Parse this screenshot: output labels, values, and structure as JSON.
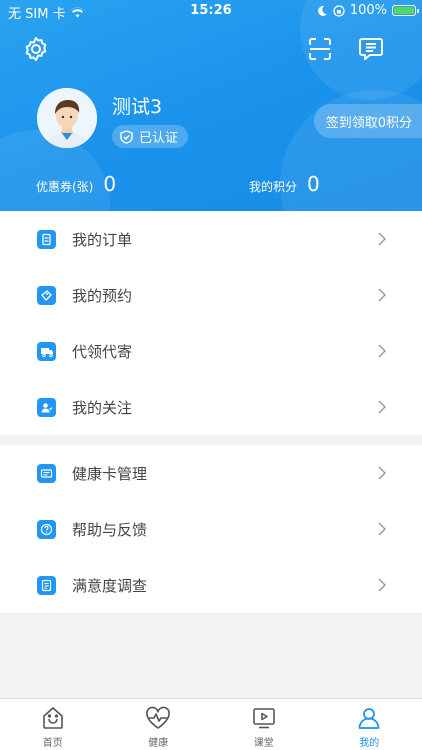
{
  "status_bar": {
    "carrier": "无 SIM 卡",
    "time": "15:26",
    "battery": "100%"
  },
  "profile": {
    "name": "测试3",
    "verified_label": "已认证",
    "signin_label": "签到领取0积分",
    "coupon_label": "优惠券(张)",
    "coupon_value": "0",
    "points_label": "我的积分",
    "points_value": "0"
  },
  "menu_group_1": [
    {
      "label": "我的订单",
      "icon": "order-icon"
    },
    {
      "label": "我的预约",
      "icon": "appointment-icon"
    },
    {
      "label": "代领代寄",
      "icon": "delivery-icon"
    },
    {
      "label": "我的关注",
      "icon": "follow-icon"
    }
  ],
  "menu_group_2": [
    {
      "label": "健康卡管理",
      "icon": "health-card-icon"
    },
    {
      "label": "帮助与反馈",
      "icon": "help-icon"
    },
    {
      "label": "满意度调查",
      "icon": "survey-icon"
    }
  ],
  "tabs": [
    {
      "label": "首页",
      "icon": "home-icon"
    },
    {
      "label": "健康",
      "icon": "health-icon"
    },
    {
      "label": "课堂",
      "icon": "classroom-icon"
    },
    {
      "label": "我的",
      "icon": "profile-icon",
      "active": true
    }
  ],
  "colors": {
    "accent": "#1e90ee",
    "header": "#1b93ec"
  }
}
